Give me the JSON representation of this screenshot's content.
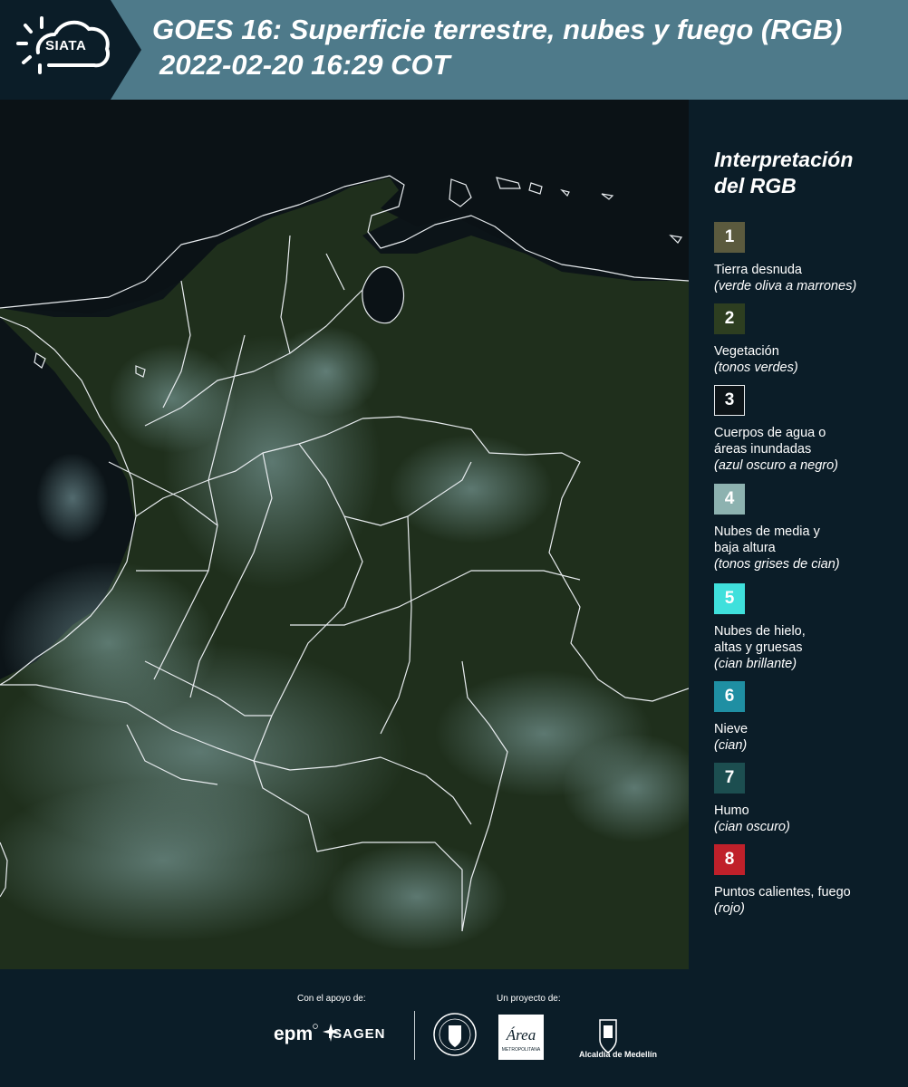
{
  "header": {
    "logo_text": "SIATA",
    "title": "GOES 16: Superficie terrestre, nubes y fuego (RGB)",
    "subtitle": "2022-02-20 16:29 COT",
    "band_color": "#4e7a8a"
  },
  "legend": {
    "title_line1": "Interpretación",
    "title_line2": "del RGB",
    "items": [
      {
        "number": "1",
        "label": "Tierra desnuda",
        "desc": "(verde oliva a marrones)",
        "color": "#5b5a3e"
      },
      {
        "number": "2",
        "label": "Vegetación",
        "desc": "(tonos verdes)",
        "color": "#2d3e20"
      },
      {
        "number": "3",
        "label1": "Cuerpos de agua o",
        "label2": "áreas inundadas",
        "desc": "(azul oscuro a negro)",
        "color": "#0d1418"
      },
      {
        "number": "4",
        "label1": "Nubes de media y",
        "label2": "baja altura",
        "desc": "(tonos grises de cian)",
        "color": "#8db2b0"
      },
      {
        "number": "5",
        "label1": "Nubes de hielo,",
        "label2": "altas y gruesas",
        "desc": "(cian brillante)",
        "color": "#3fe0dc"
      },
      {
        "number": "6",
        "label": "Nieve",
        "desc": "(cian)",
        "color": "#1f8fa3"
      },
      {
        "number": "7",
        "label": "Humo",
        "desc": "(cian oscuro)",
        "color": "#1c4e50"
      },
      {
        "number": "8",
        "label": "Puntos calientes, fuego",
        "desc": "(rojo)",
        "color": "#c0202a"
      }
    ]
  },
  "footer": {
    "support_label": "Con el apoyo de:",
    "project_label": "Un proyecto de:",
    "epm": "epm",
    "isagen": "ISAGEN",
    "area_text": "Área",
    "area_sub": "METROPOLITANA",
    "medellin": "Alcaldía de Medellín"
  }
}
